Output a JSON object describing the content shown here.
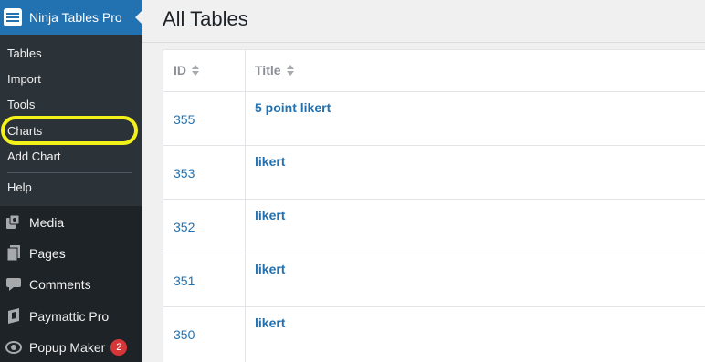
{
  "sidebar": {
    "plugin_title": "Ninja Tables Pro",
    "submenu": [
      "Tables",
      "Import",
      "Tools",
      "Charts",
      "Add Chart",
      "Help"
    ],
    "menu": [
      {
        "label": "Media",
        "icon": "media-icon"
      },
      {
        "label": "Pages",
        "icon": "pages-icon"
      },
      {
        "label": "Comments",
        "icon": "comments-icon"
      },
      {
        "label": "Paymattic Pro",
        "icon": "paymattic-icon"
      },
      {
        "label": "Popup Maker",
        "icon": "popup-maker-icon",
        "badge": "2"
      }
    ],
    "highlight_color": "#f2f21a",
    "accent": "#2271b1"
  },
  "main": {
    "title": "All Tables",
    "columns": [
      "ID",
      "Title"
    ],
    "rows": [
      {
        "id": "355",
        "title": "5 point likert"
      },
      {
        "id": "353",
        "title": "likert"
      },
      {
        "id": "352",
        "title": "likert"
      },
      {
        "id": "351",
        "title": "likert"
      },
      {
        "id": "350",
        "title": "likert"
      }
    ]
  }
}
